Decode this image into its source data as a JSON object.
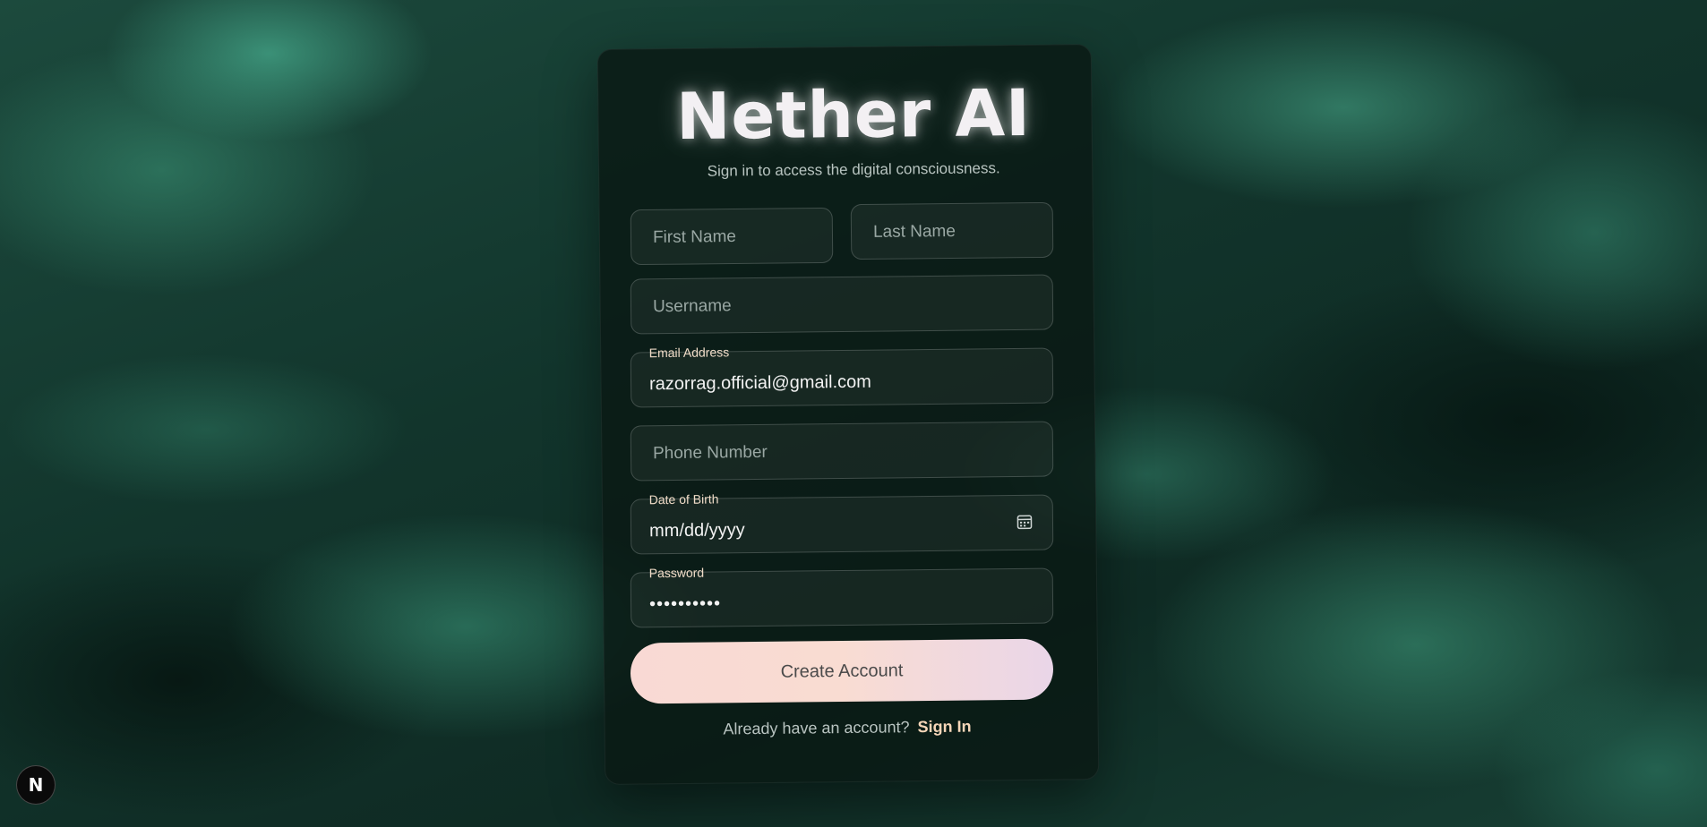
{
  "app": {
    "title": "Nether AI",
    "subtitle": "Sign in to access the digital consciousness."
  },
  "form": {
    "first_name": {
      "placeholder": "First Name",
      "value": ""
    },
    "last_name": {
      "placeholder": "Last Name",
      "value": ""
    },
    "username": {
      "placeholder": "Username",
      "value": ""
    },
    "email": {
      "label": "Email Address",
      "value": "razorrag.official@gmail.com"
    },
    "phone": {
      "placeholder": "Phone Number",
      "value": ""
    },
    "dob": {
      "label": "Date of Birth",
      "value": "mm/dd/yyyy",
      "icon": "calendar-icon"
    },
    "password": {
      "label": "Password",
      "value": "••••••••••"
    },
    "submit_label": "Create Account"
  },
  "footer": {
    "prompt": "Already have an account?",
    "link": "Sign In"
  },
  "badge": {
    "letter": "N"
  },
  "colors": {
    "accent": "#f6d6b8",
    "button_start": "#f9d9d4",
    "button_end": "#ead6e8",
    "background": "#12352c"
  }
}
